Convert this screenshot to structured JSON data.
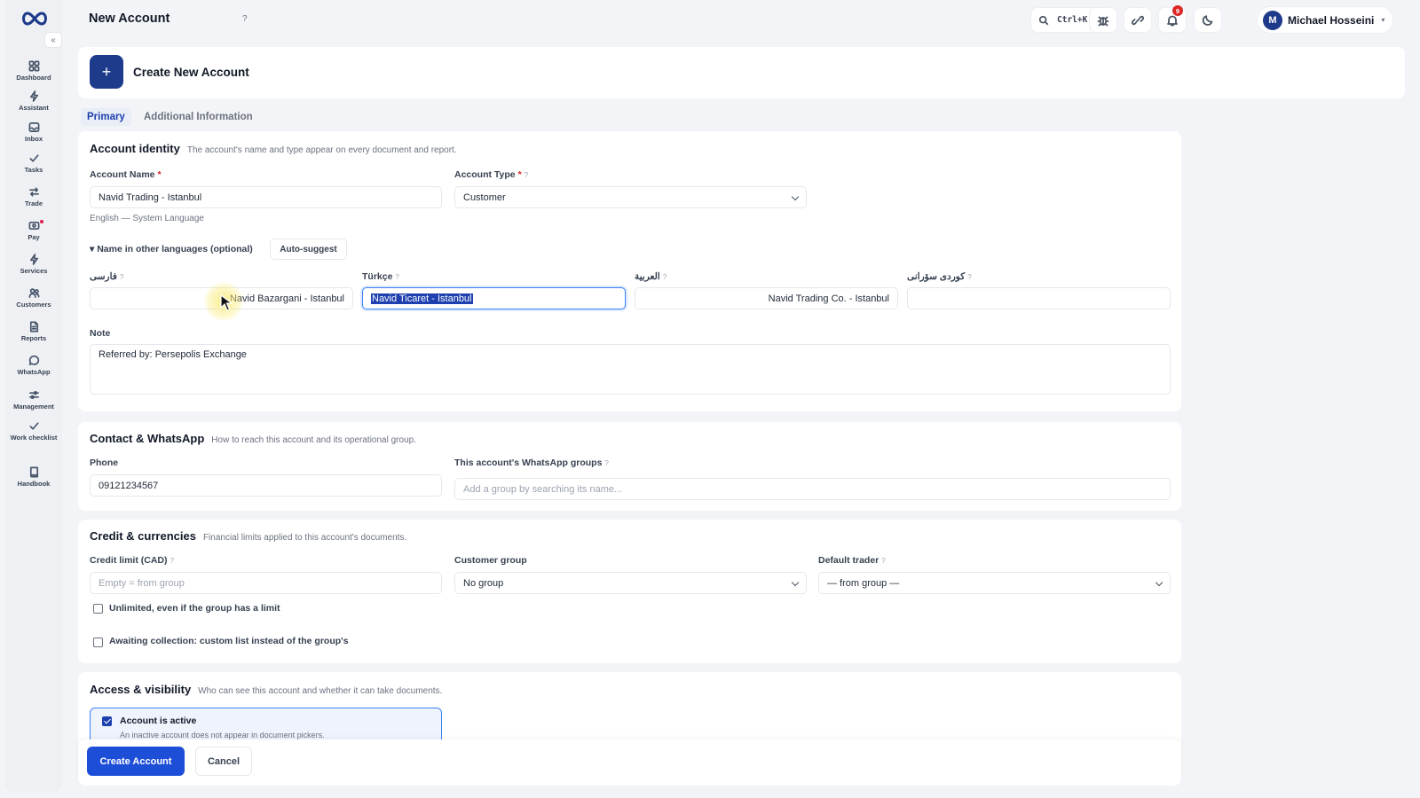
{
  "sidebar": {
    "collapse_glyph": "«",
    "items": [
      {
        "label": "Dashboard",
        "icon": "dashboard-icon"
      },
      {
        "label": "Assistant",
        "icon": "bolt-icon"
      },
      {
        "label": "Inbox",
        "icon": "inbox-icon"
      },
      {
        "label": "Tasks",
        "icon": "check-icon"
      },
      {
        "label": "Trade",
        "icon": "swap-icon"
      },
      {
        "label": "Pay",
        "icon": "wallet-icon"
      },
      {
        "label": "Services",
        "icon": "bolt-icon"
      },
      {
        "label": "Customers",
        "icon": "users-icon"
      },
      {
        "label": "Reports",
        "icon": "file-icon"
      },
      {
        "label": "WhatsApp",
        "icon": "chat-icon"
      },
      {
        "label": "Management",
        "icon": "sliders-icon"
      },
      {
        "label": "Work checklist",
        "icon": "check-icon"
      },
      {
        "label": "Handbook",
        "icon": "book-icon"
      }
    ]
  },
  "topbar": {
    "title": "New Account",
    "help_glyph": "?",
    "search_shortcut": "Ctrl+K",
    "notifications_count": "9",
    "user_initial": "M",
    "user_name": "Michael Hosseini",
    "user_caret": "▾"
  },
  "header": {
    "plus_glyph": "+",
    "title": "Create New Account"
  },
  "tabs": [
    "Primary",
    "Additional Information"
  ],
  "identity": {
    "title": "Account identity",
    "desc": "The account's name and type appear on every document and report.",
    "name_label": "Account Name",
    "required_mark": "*",
    "name_value": "Navid Trading - Istanbul",
    "name_hint": "English — System Language",
    "type_label": "Account Type",
    "type_value": "Customer",
    "other_lang_toggle": "▾ Name in other languages (optional)",
    "auto_suggest": "Auto-suggest",
    "languages": [
      {
        "label": "فارسی",
        "value": "Navid Bazargani - Istanbul"
      },
      {
        "label": "Türkçe",
        "value": "Navid Ticaret - Istanbul"
      },
      {
        "label": "العربية",
        "value": "Navid Trading Co. - Istanbul"
      },
      {
        "label": "کوردی سۆرانی",
        "value": ""
      }
    ],
    "note_label": "Note",
    "note_value": "Referred by: Persepolis Exchange"
  },
  "contact": {
    "title": "Contact & WhatsApp",
    "desc": "How to reach this account and its operational group.",
    "phone_label": "Phone",
    "phone_value": "09121234567",
    "groups_label": "This account's WhatsApp groups",
    "groups_placeholder": "Add a group by searching its name..."
  },
  "credit": {
    "title": "Credit & currencies",
    "desc": "Financial limits applied to this account's documents.",
    "limit_label": "Credit limit (CAD)",
    "limit_placeholder": "Empty = from group",
    "group_label": "Customer group",
    "group_value": "No group",
    "trader_label": "Default trader",
    "trader_value": "— from group —",
    "unlimited_label": "Unlimited, even if the group has a limit",
    "awaiting_label": "Awaiting collection: custom list instead of the group's"
  },
  "access": {
    "title": "Access & visibility",
    "desc": "Who can see this account and whether it can take documents.",
    "active_label": "Account is active",
    "active_hint": "An inactive account does not appear in document pickers.",
    "active_checked": true
  },
  "footer": {
    "create_label": "Create Account",
    "cancel_label": "Cancel"
  },
  "colors": {
    "accent": "#1d4ed8",
    "brand_dark": "#1e3a8a",
    "badge": "#dc2626"
  }
}
